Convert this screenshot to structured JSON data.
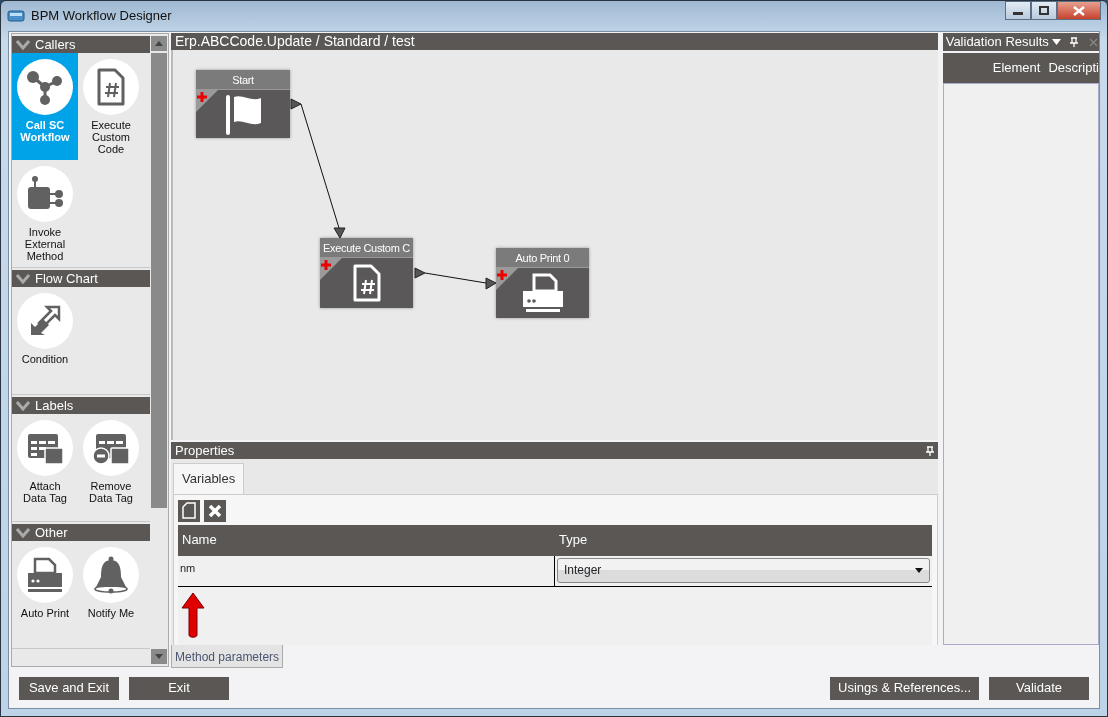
{
  "window": {
    "title": "BPM Workflow Designer"
  },
  "toolbox": {
    "sections": [
      {
        "title": "Callers",
        "expanded": true,
        "items": [
          {
            "label": "Call SC Workflow",
            "selected": true
          },
          {
            "label": "Execute Custom Code",
            "selected": false
          },
          {
            "label": "Invoke External Method",
            "selected": false
          }
        ]
      },
      {
        "title": "Flow Chart",
        "expanded": true,
        "items": [
          {
            "label": "Condition",
            "selected": false
          }
        ]
      },
      {
        "title": "Labels",
        "expanded": true,
        "items": [
          {
            "label": "Attach Data Tag",
            "selected": false
          },
          {
            "label": "Remove Data Tag",
            "selected": false
          }
        ]
      },
      {
        "title": "Other",
        "expanded": true,
        "items": [
          {
            "label": "Auto Print",
            "selected": false
          },
          {
            "label": "Notify Me",
            "selected": false
          }
        ]
      }
    ]
  },
  "designer": {
    "breadcrumb": "Erp.ABCCode.Update / Standard / test",
    "nodes": [
      {
        "title": "Start"
      },
      {
        "title": "Execute Custom C"
      },
      {
        "title": "Auto Print 0"
      }
    ]
  },
  "properties": {
    "title": "Properties",
    "tabs": [
      {
        "label": "Variables",
        "selected": true
      }
    ],
    "columns": [
      "Name",
      "Type"
    ],
    "rows": [
      {
        "name": "nm",
        "type": "Integer"
      }
    ],
    "bottom_tabs": [
      {
        "label": "Method parameters",
        "selected": true
      }
    ]
  },
  "validation": {
    "title": "Validation Results",
    "columns": [
      "Element",
      "Descripti"
    ]
  },
  "buttons_left": [
    "Save and Exit",
    "Exit"
  ],
  "buttons_right": [
    "Usings & References...",
    "Validate"
  ]
}
